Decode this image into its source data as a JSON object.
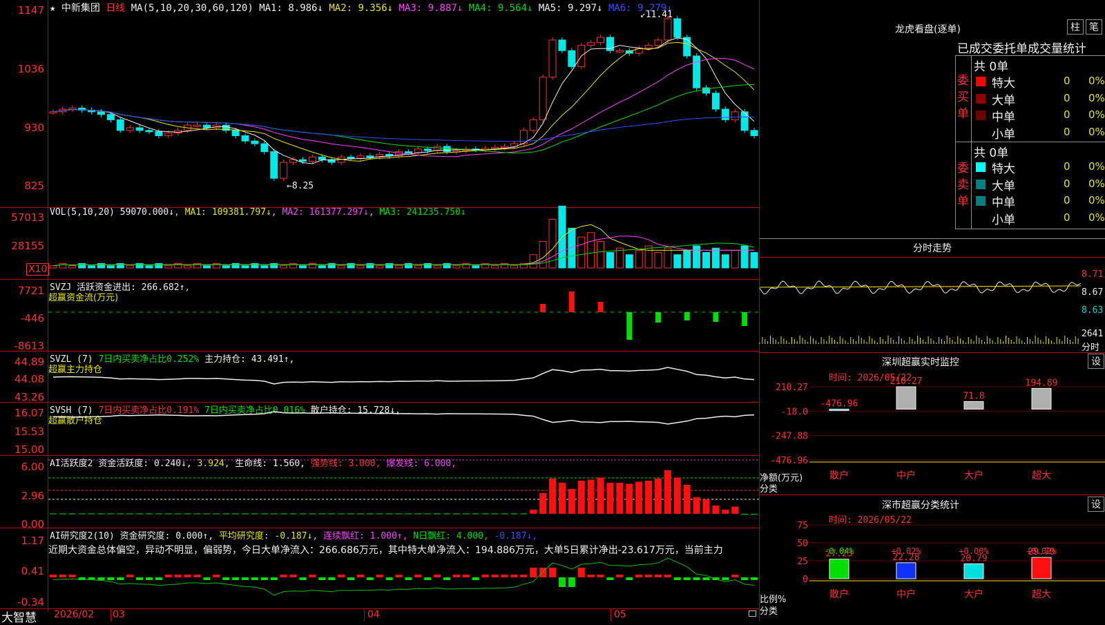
{
  "main": {
    "stock_name": "中新集团",
    "period": "日线",
    "ma_params": "MA(5,10,20,30,60,120)",
    "ma1": "MA1: 8.986↓",
    "ma2": "MA2: 9.356↓",
    "ma3": "MA3: 9.887↓",
    "ma4": "MA4: 9.564↓",
    "ma5": "MA5: 9.297↓",
    "ma6": "MA6: 9.279↓",
    "y_ticks": [
      "1147",
      "1036",
      "930",
      "825"
    ],
    "high_label": "11.41",
    "low_label": "8.25"
  },
  "vol": {
    "title": "VOL(5,10,20)",
    "value": "59070.000↓",
    "ma1": "MA1: 109381.797↓",
    "ma2": "MA2: 161377.297↓",
    "ma3": "MA3: 241235.750↓",
    "y_ticks": [
      "57013",
      "28155"
    ],
    "unit": "X10"
  },
  "svzj": {
    "title": "SVZJ",
    "text1": "活跃资金进出: 266.682↑",
    "text2": "超赢资金流(万元)",
    "y_ticks": [
      "7721",
      "-446",
      "-8613"
    ]
  },
  "svzl": {
    "title": "SVZL (7)",
    "text1": "7日内买卖净占比0.252%",
    "text2": "主力持仓: 43.491↑,",
    "text3": "超赢主力持仓",
    "y_ticks": [
      "44.89",
      "44.08",
      "43.26"
    ]
  },
  "svsh": {
    "title": "SVSH (7)",
    "text1": "7日内买卖净占比0.191%",
    "text2": "7日内买卖净占比0.016%",
    "text3": "散户持仓: 15.728↓,",
    "text4": "超赢散户持仓",
    "y_ticks": [
      "16.07",
      "15.53",
      "15.00"
    ]
  },
  "ai1": {
    "title": "AI活跃度2",
    "t1": "资金活跃度: 0.240↓,",
    "t2": "3.924,",
    "t3": "生命线: 1.560,",
    "t4": "强势线: 3.000,",
    "t5": "爆发线: 6.000,",
    "y_ticks": [
      "6.00",
      "2.96",
      "0.00"
    ]
  },
  "ai2": {
    "title": "AI研究度2(10)",
    "t1": "资金研究度: 0.000↑,",
    "t2": "平均研究度: -0.187↓,",
    "t3": "连续飘红: 1.000↑,",
    "t4": "N日飘红: 4.000,",
    "t5": "-0.187↓,",
    "summary": "近期大资金总体偏空，异动不明显，偏弱势，今日大单净流入：266.686万元，其中特大单净流入：194.886万元，大单5日累计净出-23.617万元，当前主力",
    "y_ticks": [
      "1.17",
      "0.41",
      "-0.34"
    ]
  },
  "bottom": {
    "brand": "大智慧",
    "dates": [
      "2026/02",
      "03",
      "04",
      "05"
    ]
  },
  "dragon": {
    "title": "龙虎看盘(逐单)",
    "btn1": "柱",
    "btn2": "笔",
    "tab1": "已成交",
    "tab2": "委托单",
    "tab3": "成交量统计",
    "buy_label": "委买单",
    "sell_label": "委卖单",
    "buy_total": "共 0单",
    "sell_total": "共 0单",
    "rows": [
      {
        "name": "特大",
        "count": "0",
        "pct": "0%"
      },
      {
        "name": "大单",
        "count": "0",
        "pct": "0%"
      },
      {
        "name": "中单",
        "count": "0",
        "pct": "0%"
      },
      {
        "name": "小单",
        "count": "0",
        "pct": "0%"
      }
    ],
    "buy_colors": [
      "#ff0000",
      "#900000",
      "#700000",
      "#000000"
    ],
    "sell_colors": [
      "#00ffff",
      "#008080",
      "#008080",
      "#000000"
    ]
  },
  "intraday": {
    "title": "分时走势",
    "y_ticks": [
      "8.71",
      "8.67",
      "8.63"
    ],
    "vol_label": "2641",
    "vol_unit": "分时"
  },
  "monitor": {
    "title": "深圳超赢实时监控",
    "btn": "设",
    "time": "时间: 2026/05/22",
    "y_ticks": [
      "210.27",
      "-18.0",
      "-247.88",
      "-476.96"
    ],
    "ylabel": "净额(万元)",
    "xlabel": "分类",
    "cats": [
      "散户",
      "中户",
      "大户",
      "超大"
    ],
    "values": [
      -476.96,
      210.27,
      71.8,
      194.89
    ],
    "value_labels": [
      "-476.96",
      "210.27",
      "71.8",
      "194.89"
    ]
  },
  "stats": {
    "title": "深市超赢分类统计",
    "btn": "设",
    "time": "时间: 2026/05/22",
    "y_ticks": [
      "75",
      "50",
      "25",
      "0"
    ],
    "ylabel": "比例%",
    "xlabel": "分类",
    "cats": [
      "散户",
      "中户",
      "大户",
      "超大"
    ],
    "values": [
      27.23,
      22.28,
      20.79,
      29.7
    ],
    "value_labels": [
      "27.23",
      "22.28",
      "20.79",
      "29.70"
    ],
    "change_labels": [
      "-0.04%",
      "+0.02%",
      "+0.00%",
      "+0.02%"
    ]
  },
  "chart_data": {
    "type": "bar",
    "categories": [
      "散户",
      "中户",
      "大户",
      "超大"
    ],
    "series": [
      {
        "name": "净额(万元)",
        "values": [
          -476.96,
          210.27,
          71.8,
          194.89
        ]
      },
      {
        "name": "比例%",
        "values": [
          27.23,
          22.28,
          20.79,
          29.7
        ]
      }
    ]
  }
}
